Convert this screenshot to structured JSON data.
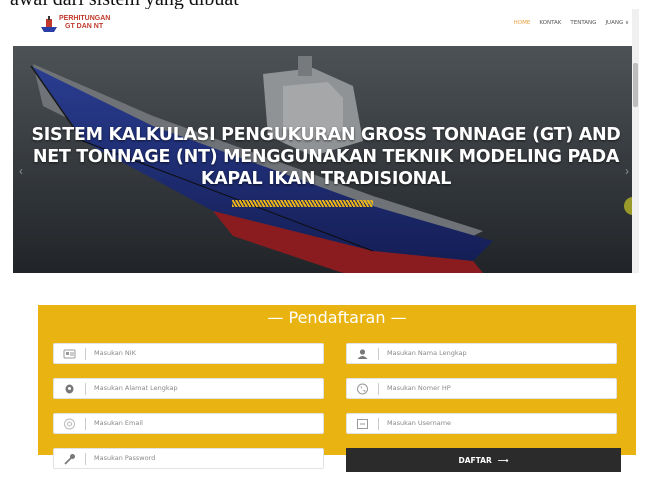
{
  "caption": "awal dari sistem yang dibuat",
  "site": {
    "logo_text_line1": "PERHITUNGAN",
    "logo_text_line2": "GT DAN NT",
    "nav": [
      {
        "label": "HOME",
        "active": true
      },
      {
        "label": "KONTAK",
        "active": false
      },
      {
        "label": "TENTANG",
        "active": false
      },
      {
        "label": "JUANG ∨",
        "active": false
      }
    ],
    "hero_title_line1": "SISTEM KALKULASI PENGUKURAN GROSS TONNAGE (GT) AND",
    "hero_title_line2": "NET TONNAGE (NT) MENGGUNAKAN TEKNIK MODELING PADA",
    "hero_title_line3": "KAPAL IKAN TRADISIONAL",
    "prev_arrow": "‹",
    "next_arrow": "›"
  },
  "form": {
    "title": "— Pendaftaran —",
    "fields": [
      {
        "placeholder": "Masukan NIK",
        "icon": "id-card-icon"
      },
      {
        "placeholder": "Masukan Nama Lengkap",
        "icon": "user-icon"
      },
      {
        "placeholder": "Masukan Alamat Lengkap",
        "icon": "location-icon"
      },
      {
        "placeholder": "Masukan Nomer HP",
        "icon": "phone-icon"
      },
      {
        "placeholder": "Masukan Email",
        "icon": "email-icon"
      },
      {
        "placeholder": "Masukan Username",
        "icon": "username-icon"
      },
      {
        "placeholder": "Masukan Password",
        "icon": "key-icon"
      }
    ],
    "submit_label": "DAFTAR",
    "submit_arrow": "⟶"
  },
  "colors": {
    "form_bg": "#e9b412",
    "nav_active": "#e8a03c",
    "button_bg": "#2b2b2b",
    "hull_blue": "#2a3fa6",
    "hull_red": "#c0272d"
  }
}
